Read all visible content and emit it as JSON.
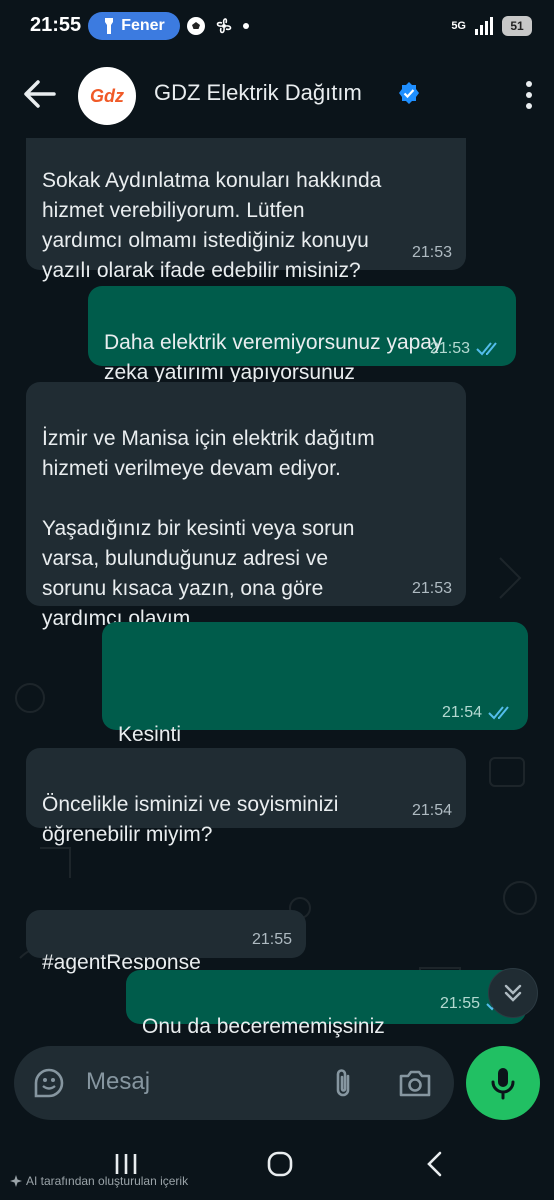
{
  "status_bar": {
    "time": "21:55",
    "pill_label": "Fener",
    "network": "5G",
    "battery": "51"
  },
  "header": {
    "back_icon": "arrow-left-icon",
    "avatar_text": "Gdz",
    "title": "GDZ Elektrik Dağıtım",
    "verified_icon": "verified-badge-icon",
    "menu_icon": "more-vertical-icon"
  },
  "messages": [
    {
      "dir": "in",
      "text": "Sokak Aydınlatma konuları hakkında\nhizmet verebiliyorum. Lütfen\nyardımcı olmamı istediğiniz konuyu\nyazılı olarak ifade edebilir misiniz?",
      "time": "21:53"
    },
    {
      "dir": "out",
      "text": "Daha elektrik veremiyorsunuz yapay\nzeka yatırımı yapıyorsunuz",
      "time": "21:53",
      "read": true
    },
    {
      "dir": "in",
      "text": "İzmir ve Manisa için elektrik dağıtım\nhizmeti verilmeye devam ediyor.\n\nYaşadığınız bir kesinti veya sorun\nvarsa, bulunduğunuz adresi ve\nsorunu kısaca yazın, ona göre\nyardımcı olayım.",
      "time": "21:53"
    },
    {
      "dir": "out",
      "text": "Kesinti",
      "time": "21:54",
      "read": true
    },
    {
      "dir": "in",
      "text": "Öncelikle isminizi ve soyisminizi\nöğrenebilir miyim?",
      "time": "21:54"
    },
    {
      "dir": "in",
      "text": "#agentResponse",
      "time": "21:55"
    },
    {
      "dir": "out",
      "text": "Onu da becerememişsiniz",
      "time": "21:55",
      "read": true
    }
  ],
  "input": {
    "placeholder": "Mesaj",
    "emoji_icon": "sticker-icon",
    "attach_icon": "paperclip-icon",
    "camera_icon": "camera-icon",
    "mic_icon": "microphone-icon"
  },
  "scroll_button_icon": "chevron-double-down-icon",
  "nav": {
    "recents_icon": "recents-icon",
    "home_icon": "home-icon",
    "back_icon": "back-icon"
  },
  "footer_note": "AI tarafından oluşturulan içerik",
  "colors": {
    "background": "#0b141a",
    "incoming": "#202c33",
    "outgoing": "#005c4b",
    "accent": "#21c063",
    "read_ticks": "#53bdeb"
  }
}
